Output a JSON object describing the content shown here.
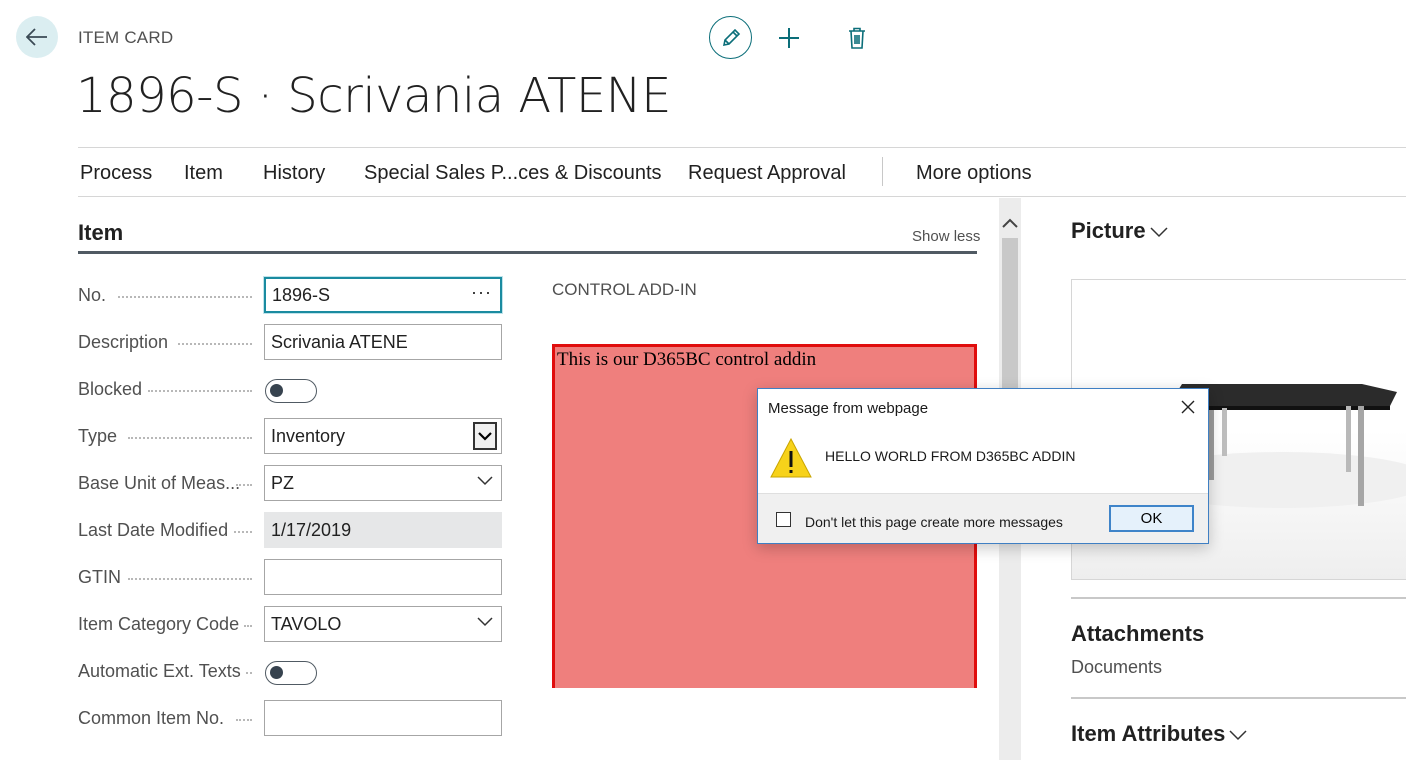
{
  "header": {
    "page_kind": "ITEM CARD",
    "title": "1896-S · Scrivania ATENE",
    "actions": {
      "edit": "pencil-icon",
      "new": "plus-icon",
      "delete": "trash-icon"
    }
  },
  "action_bar": {
    "items": [
      "Process",
      "Item",
      "History",
      "Special Sales P...ces & Discounts",
      "Request Approval"
    ],
    "more": "More options"
  },
  "item_tab": {
    "title": "Item",
    "show_less": "Show less",
    "fields": {
      "no": {
        "label": "No.",
        "value": "1896-S"
      },
      "description": {
        "label": "Description",
        "value": "Scrivania ATENE"
      },
      "blocked": {
        "label": "Blocked",
        "value": false
      },
      "type": {
        "label": "Type",
        "value": "Inventory"
      },
      "base_unit": {
        "label": "Base Unit of Meas...",
        "value": "PZ"
      },
      "last_date": {
        "label": "Last Date Modified",
        "value": "1/17/2019"
      },
      "gtin": {
        "label": "GTIN",
        "value": ""
      },
      "category": {
        "label": "Item Category Code",
        "value": "TAVOLO"
      },
      "auto_ext": {
        "label": "Automatic Ext. Texts",
        "value": false
      },
      "common_no": {
        "label": "Common Item No.",
        "value": ""
      }
    }
  },
  "addin": {
    "caption": "CONTROL ADD-IN",
    "text": "This is our D365BC control addin",
    "bg_color": "#ef7f7d",
    "border_color": "#e00d0d"
  },
  "factbox": {
    "picture_title": "Picture",
    "attachments_title": "Attachments",
    "documents_link": "Documents",
    "attributes_title": "Item Attributes"
  },
  "dialog": {
    "title": "Message from webpage",
    "message": "HELLO WORLD FROM D365BC ADDIN",
    "checkbox_label": "Don't let this page create more messages",
    "ok_label": "OK"
  },
  "colors": {
    "accent": "#0b6e79",
    "back_button_bg": "#dbeef1"
  }
}
